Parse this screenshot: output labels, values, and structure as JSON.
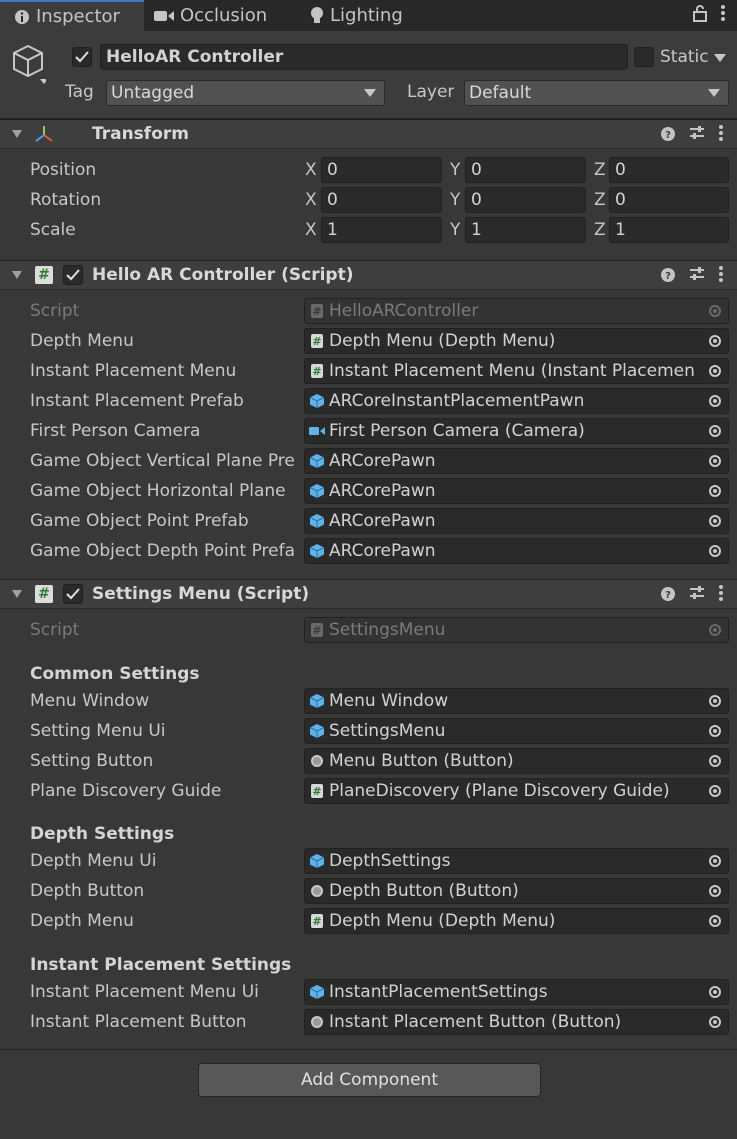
{
  "tabs": [
    {
      "label": "Inspector",
      "icon": "info-icon"
    },
    {
      "label": "Occlusion",
      "icon": "camera-icon"
    },
    {
      "label": "Lighting",
      "icon": "bulb-icon"
    }
  ],
  "header": {
    "object_name": "HelloAR Controller",
    "static_label": "Static",
    "tag_label": "Tag",
    "tag_value": "Untagged",
    "layer_label": "Layer",
    "layer_value": "Default"
  },
  "transform": {
    "title": "Transform",
    "rows": [
      {
        "label": "Position",
        "x": "0",
        "y": "0",
        "z": "0"
      },
      {
        "label": "Rotation",
        "x": "0",
        "y": "0",
        "z": "0"
      },
      {
        "label": "Scale",
        "x": "1",
        "y": "1",
        "z": "1"
      }
    ],
    "axis_x": "X",
    "axis_y": "Y",
    "axis_z": "Z"
  },
  "hello_ar": {
    "title": "Hello AR Controller (Script)",
    "rows": [
      {
        "label": "Script",
        "value": "HelloARController",
        "icon": "script-icon"
      },
      {
        "label": "Depth Menu",
        "value": "Depth Menu (Depth Menu)",
        "icon": "script-icon"
      },
      {
        "label": "Instant Placement Menu",
        "value": "Instant Placement Menu (Instant Placemen",
        "icon": "script-icon"
      },
      {
        "label": "Instant Placement Prefab",
        "value": "ARCoreInstantPlacementPawn",
        "icon": "prefab-icon"
      },
      {
        "label": "First Person Camera",
        "value": "First Person Camera (Camera)",
        "icon": "camera-icon"
      },
      {
        "label": "Game Object Vertical Plane Pre",
        "value": "ARCorePawn",
        "icon": "prefab-icon"
      },
      {
        "label": "Game Object Horizontal Plane",
        "value": "ARCorePawn",
        "icon": "prefab-icon"
      },
      {
        "label": "Game Object Point Prefab",
        "value": "ARCorePawn",
        "icon": "prefab-icon"
      },
      {
        "label": "Game Object Depth Point Prefa",
        "value": "ARCorePawn",
        "icon": "prefab-icon"
      }
    ]
  },
  "settings_menu": {
    "title": "Settings Menu (Script)",
    "script_label": "Script",
    "script_value": "SettingsMenu",
    "common_title": "Common Settings",
    "common_rows": [
      {
        "label": "Menu Window",
        "value": "Menu Window",
        "icon": "prefab-icon"
      },
      {
        "label": "Setting Menu Ui",
        "value": "SettingsMenu",
        "icon": "prefab-icon"
      },
      {
        "label": "Setting Button",
        "value": "Menu Button (Button)",
        "icon": "button-icon"
      },
      {
        "label": "Plane Discovery Guide",
        "value": "PlaneDiscovery (Plane Discovery Guide)",
        "icon": "script-icon"
      }
    ],
    "depth_title": "Depth Settings",
    "depth_rows": [
      {
        "label": "Depth Menu Ui",
        "value": "DepthSettings",
        "icon": "prefab-icon"
      },
      {
        "label": "Depth Button",
        "value": "Depth Button (Button)",
        "icon": "button-icon"
      },
      {
        "label": "Depth Menu",
        "value": "Depth Menu (Depth Menu)",
        "icon": "script-icon"
      }
    ],
    "instant_title": "Instant Placement Settings",
    "instant_rows": [
      {
        "label": "Instant Placement Menu Ui",
        "value": "InstantPlacementSettings",
        "icon": "prefab-icon"
      },
      {
        "label": "Instant Placement Button",
        "value": "Instant Placement Button (Button)",
        "icon": "button-icon"
      }
    ]
  },
  "add_component_label": "Add Component",
  "colors": {
    "accent": "#3a79bb",
    "background": "#383838",
    "field": "#2a2a2a",
    "prefab_blue": "#5fb3e8",
    "script_green": "#2e7d32"
  }
}
